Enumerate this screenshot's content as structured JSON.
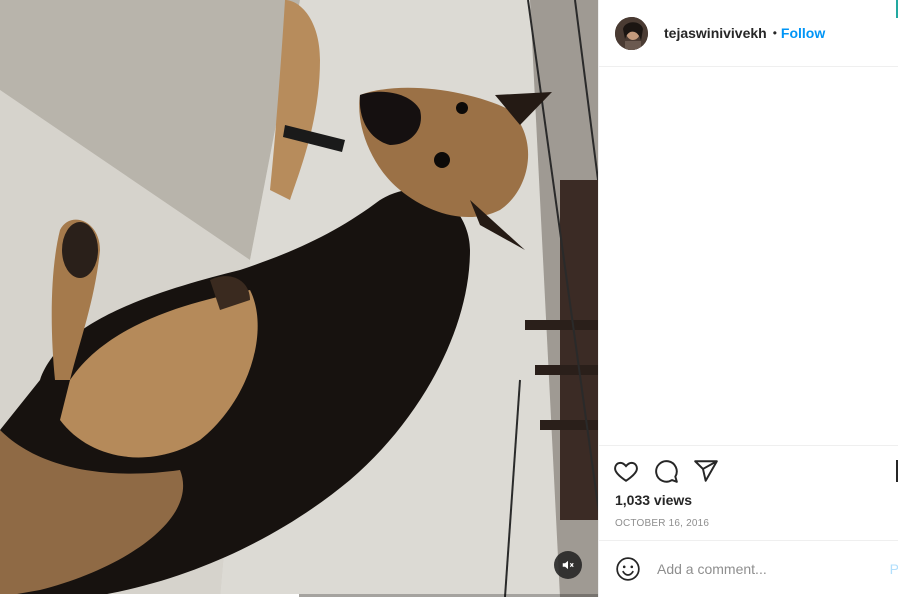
{
  "post": {
    "username": "tejaswinivivekh",
    "separator": "•",
    "follow_label": "Follow",
    "views": "1,033 views",
    "date": "OCTOBER 16, 2016"
  },
  "video": {
    "progress": 0.5,
    "muted": true,
    "icons": {
      "mute": "speaker-muted-icon"
    }
  },
  "actions": {
    "icons": [
      "heart-icon",
      "comment-icon",
      "share-icon",
      "bookmark-icon"
    ]
  },
  "comment_box": {
    "placeholder": "Add a comment...",
    "post_label": "P",
    "emoji_icon": "smiley-icon"
  },
  "colors": {
    "link": "#0095f6",
    "text": "#262626",
    "muted_text": "#8e8e8e",
    "divider": "#efefef"
  }
}
